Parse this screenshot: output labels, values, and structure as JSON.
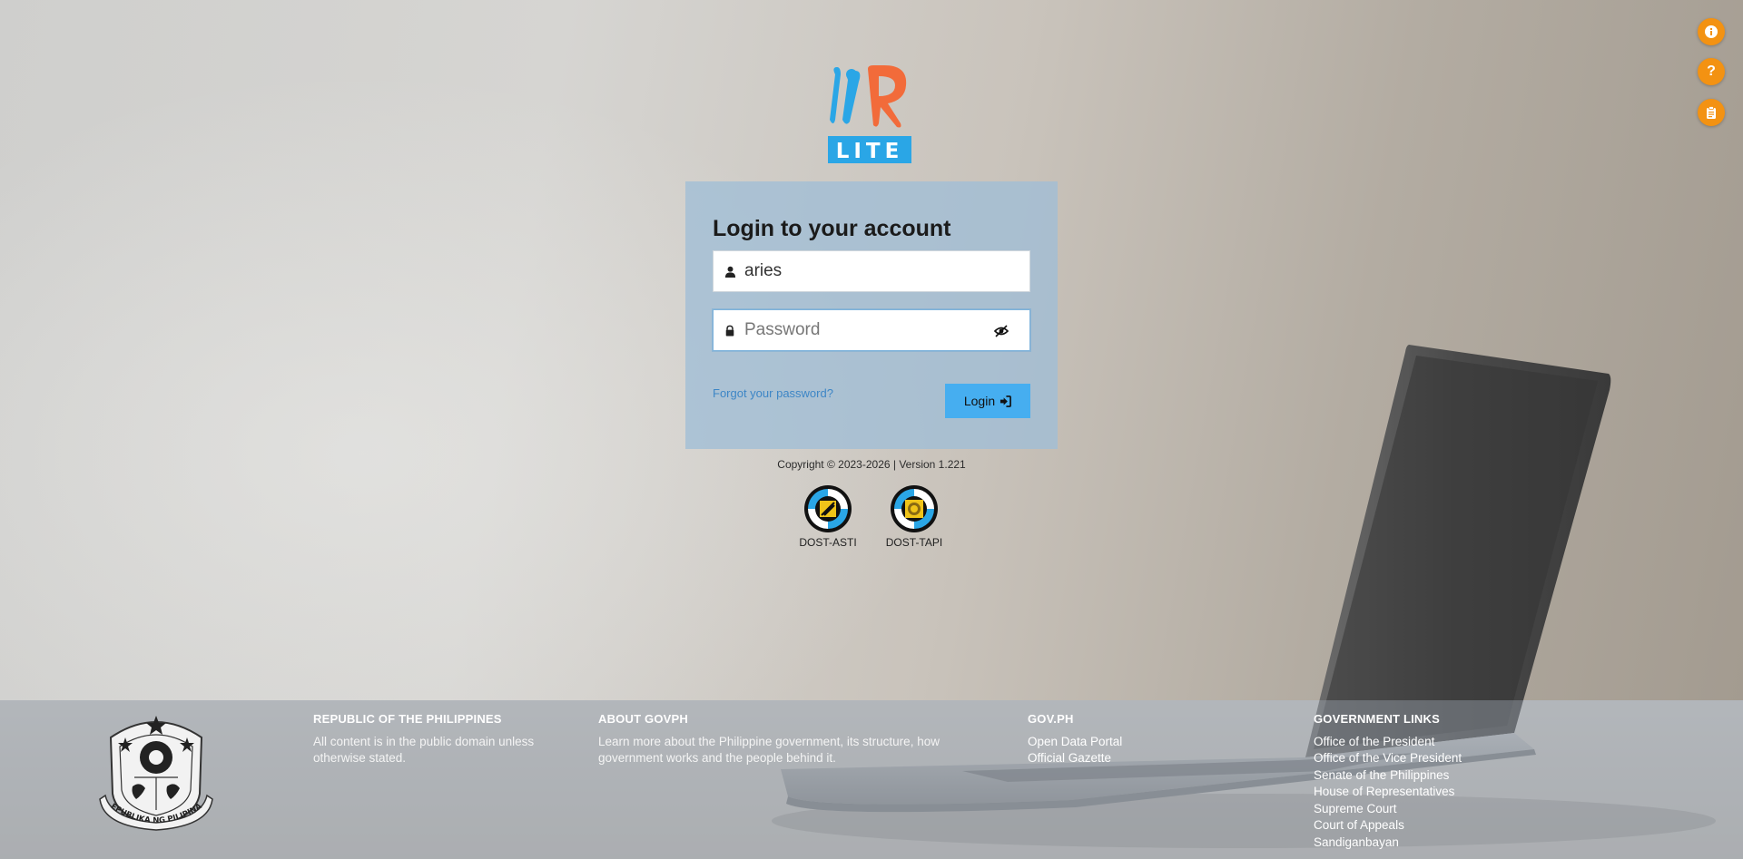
{
  "brand": {
    "logo_text": "LITE",
    "accent_blue": "#2aa6e6",
    "accent_orange": "#f26b3a"
  },
  "fabs": [
    {
      "name": "info-icon"
    },
    {
      "name": "help-icon",
      "label": "?"
    },
    {
      "name": "clipboard-icon"
    }
  ],
  "login": {
    "title": "Login to your account",
    "username_value": "aries",
    "password_placeholder": "Password",
    "forgot_label": "Forgot your password?",
    "login_label": "Login"
  },
  "copyright": "Copyright © 2023-2026 | Version 1.221",
  "partners": [
    {
      "label": "DOST-ASTI"
    },
    {
      "label": "DOST-TAPI"
    }
  ],
  "footer": {
    "seal_text": "REPUBLIKA NG PILIPINAS",
    "republic": {
      "heading": "REPUBLIC OF THE PHILIPPINES",
      "text": "All content is in the public domain unless otherwise stated."
    },
    "about": {
      "heading": "ABOUT GOVPH",
      "text": "Learn more about the Philippine government, its structure, how government works and the people behind it."
    },
    "govph": {
      "heading": "GOV.PH",
      "links": [
        "Open Data Portal",
        "Official Gazette"
      ]
    },
    "gov_links": {
      "heading": "GOVERNMENT LINKS",
      "links": [
        "Office of the President",
        "Office of the Vice President",
        "Senate of the Philippines",
        "House of Representatives",
        "Supreme Court",
        "Court of Appeals",
        "Sandiganbayan"
      ]
    }
  }
}
